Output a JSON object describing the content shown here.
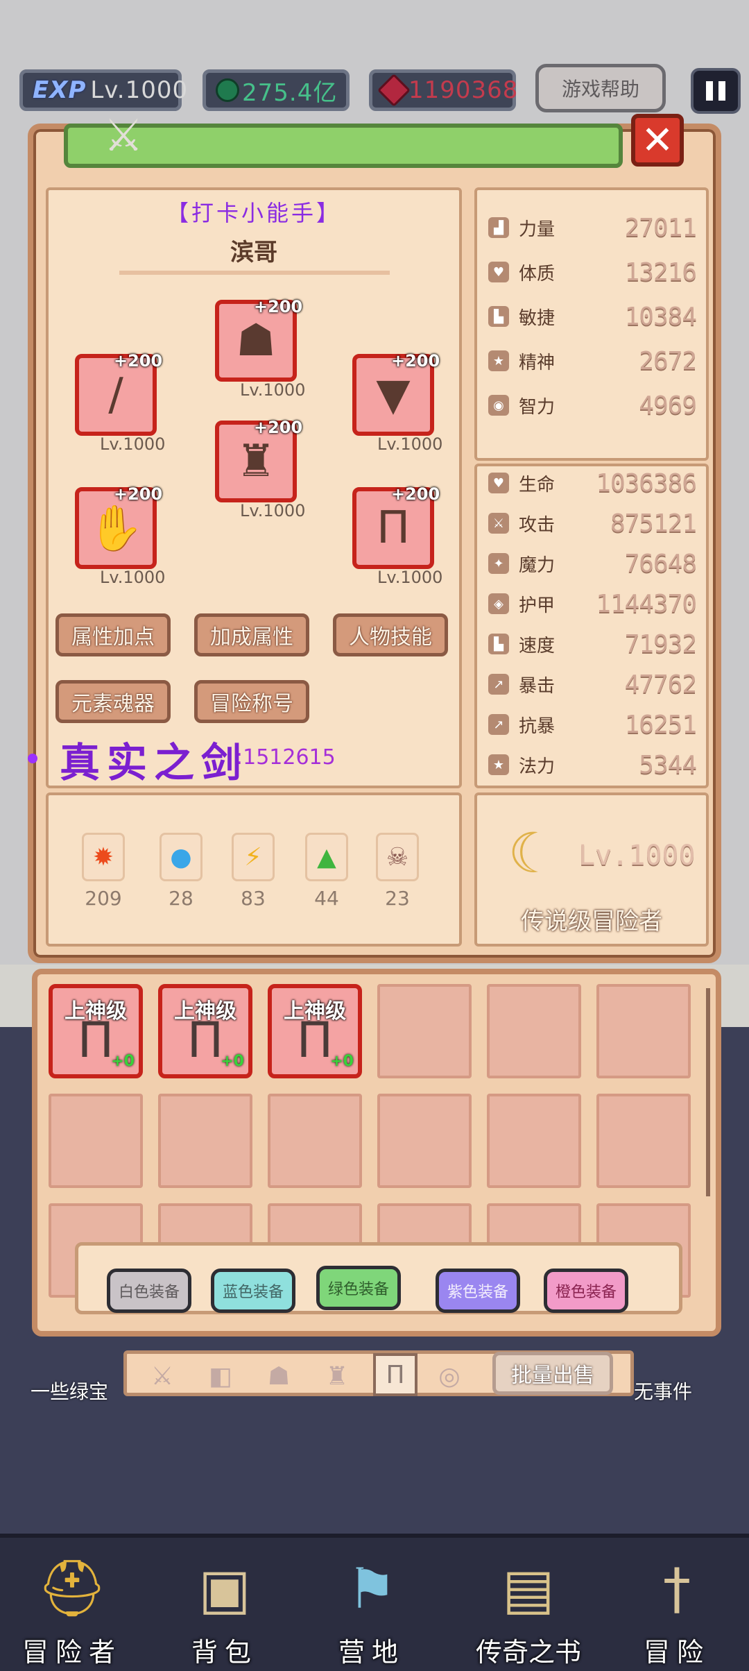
{
  "hud": {
    "exp_badge": "EXP",
    "level": "Lv.1000",
    "currency_green": "275.4亿",
    "currency_red": "1190368",
    "help_label": "游戏帮助"
  },
  "character": {
    "title": "【打卡小能手】",
    "name": "滨哥",
    "equipment": [
      {
        "slot": "helmet",
        "plus": "+200",
        "level": "Lv.1000"
      },
      {
        "slot": "weapon",
        "plus": "+200",
        "level": "Lv.1000"
      },
      {
        "slot": "amulet",
        "plus": "+200",
        "level": "Lv.1000"
      },
      {
        "slot": "armor",
        "plus": "+200",
        "level": "Lv.1000"
      },
      {
        "slot": "gloves",
        "plus": "+200",
        "level": "Lv.1000"
      },
      {
        "slot": "pants",
        "plus": "+200",
        "level": "Lv.1000"
      }
    ],
    "buttons": [
      "属性加点",
      "加成属性",
      "人物技能",
      "元素魂器",
      "冒险称号"
    ],
    "sword_name": "真实之剑",
    "sword_value": ":1512615"
  },
  "elements": [
    {
      "icon": "fire-icon",
      "value": "209"
    },
    {
      "icon": "water-icon",
      "value": "28"
    },
    {
      "icon": "lightning-icon",
      "value": "83"
    },
    {
      "icon": "earth-icon",
      "value": "44"
    },
    {
      "icon": "skull-icon",
      "value": "23"
    }
  ],
  "attributes": [
    {
      "label": "力量",
      "value": "27011"
    },
    {
      "label": "体质",
      "value": "13216"
    },
    {
      "label": "敏捷",
      "value": "10384"
    },
    {
      "label": "精神",
      "value": "2672"
    },
    {
      "label": "智力",
      "value": "4969"
    }
  ],
  "combat_stats": [
    {
      "label": "生命",
      "value": "1036386"
    },
    {
      "label": "攻击",
      "value": "875121"
    },
    {
      "label": "魔力",
      "value": "76648"
    },
    {
      "label": "护甲",
      "value": "1144370"
    },
    {
      "label": "速度",
      "value": "71932"
    },
    {
      "label": "暴击",
      "value": "47762"
    },
    {
      "label": "抗暴",
      "value": "16251"
    },
    {
      "label": "法力",
      "value": "5344"
    }
  ],
  "rank": {
    "level": "Lv.1000",
    "name": "传说级冒险者"
  },
  "inventory": {
    "items": [
      {
        "grade": "上神级",
        "plus": "+0"
      },
      {
        "grade": "上神级",
        "plus": "+0"
      },
      {
        "grade": "上神级",
        "plus": "+0"
      }
    ],
    "filters": [
      {
        "label": "白色装备",
        "color": "#c9c3c7"
      },
      {
        "label": "蓝色装备",
        "color": "#8fe0dd"
      },
      {
        "label": "绿色装备",
        "color": "#7fd67a"
      },
      {
        "label": "紫色装备",
        "color": "#9a86f0"
      },
      {
        "label": "橙色装备",
        "color": "#f29bc8"
      }
    ],
    "bulk_sell": "批量出售"
  },
  "side_texts": {
    "left": "一些绿宝",
    "right": "无事件"
  },
  "nav": [
    "冒险者",
    "背包",
    "营地",
    "传奇之书",
    "冒险"
  ]
}
